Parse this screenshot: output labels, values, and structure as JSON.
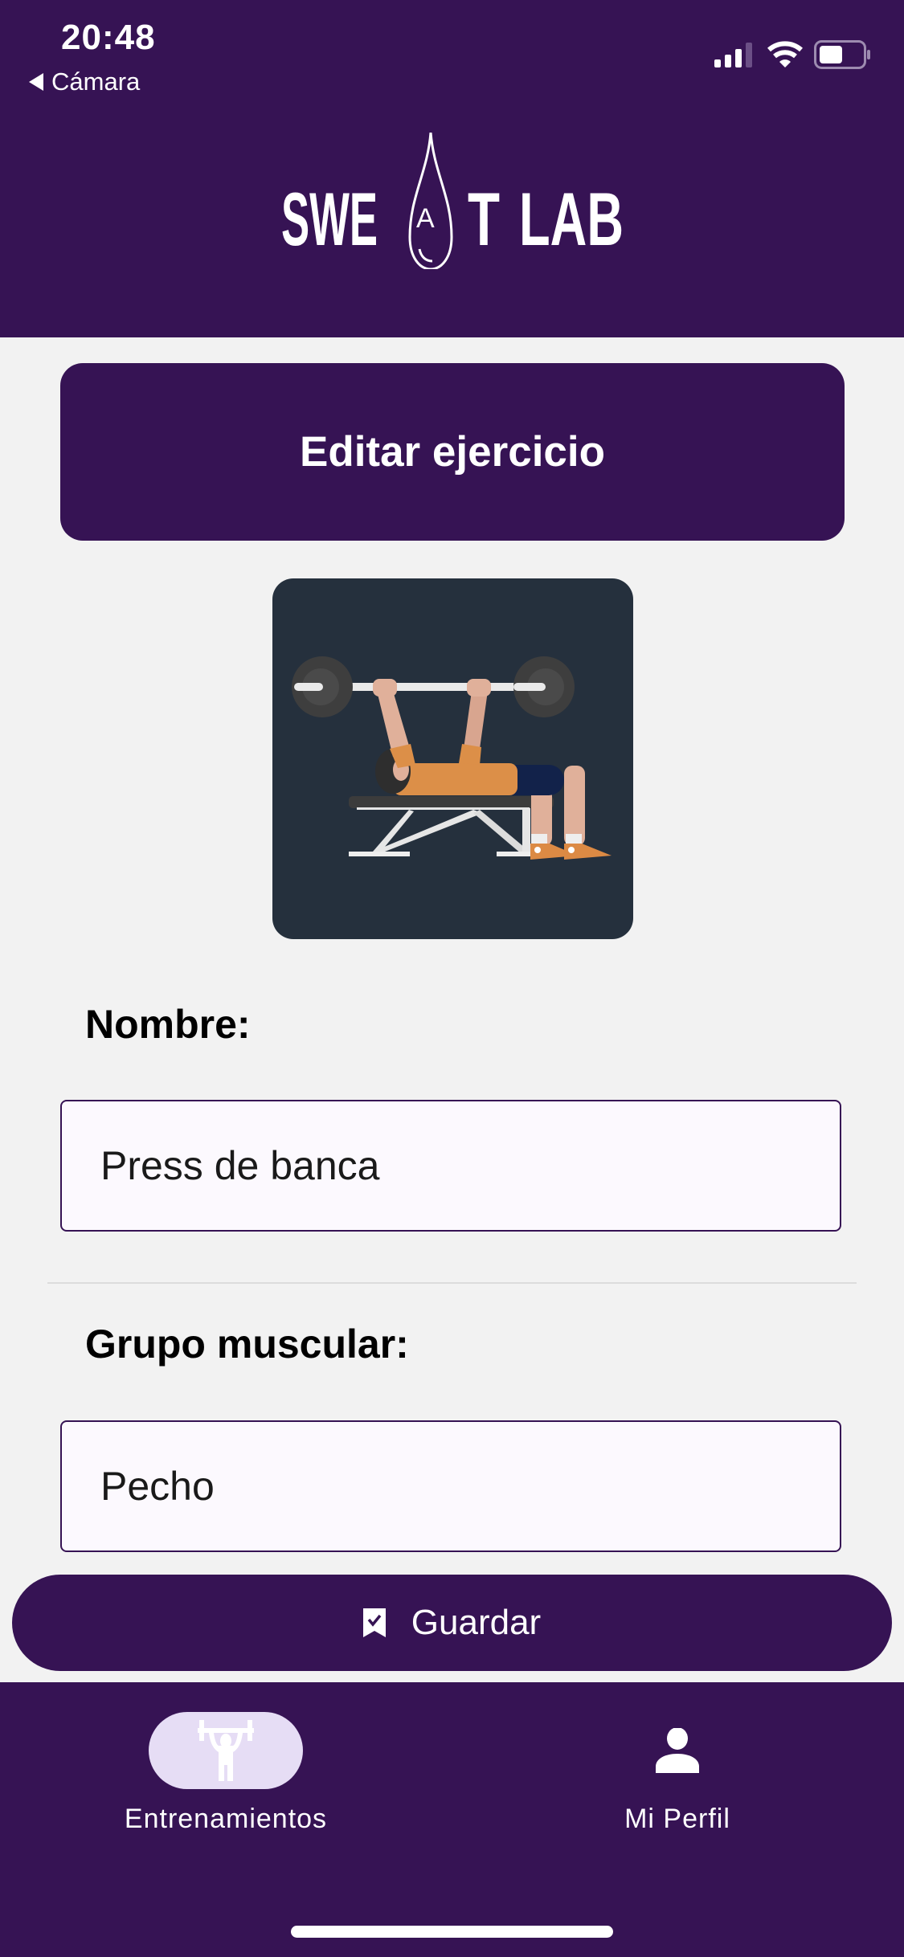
{
  "status_bar": {
    "time": "20:48",
    "back_label": "Cámara"
  },
  "header": {
    "logo_text": "SWEAT LAB"
  },
  "title": "Editar ejercicio",
  "exercise_image": {
    "icon": "bench-press-illustration"
  },
  "form": {
    "name_label": "Nombre:",
    "name_value": "Press de banca",
    "group_label": "Grupo muscular:",
    "group_value": "Pecho"
  },
  "save_button": {
    "label": "Guardar",
    "icon": "bookmark-check-icon"
  },
  "bottom_nav": {
    "items": [
      {
        "label": "Entrenamientos",
        "icon": "weightlifter-icon",
        "active": true
      },
      {
        "label": "Mi Perfil",
        "icon": "person-icon",
        "active": false
      }
    ]
  },
  "colors": {
    "primary": "#361354",
    "active_pill": "#E6DDF5",
    "background": "#F2F2F2"
  }
}
